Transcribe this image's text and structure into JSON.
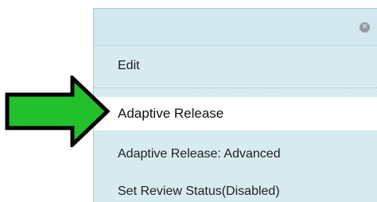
{
  "menu": {
    "close_icon": "close-icon",
    "close_glyph": "✕",
    "items": [
      {
        "label": "Edit"
      },
      {
        "label": "Adaptive Release",
        "highlighted": true
      },
      {
        "label": "Adaptive Release: Advanced"
      },
      {
        "label": "Set Review Status(Disabled)"
      }
    ]
  },
  "annotation": {
    "arrow_icon": "green-right-arrow-icon",
    "arrow_color": "#22c02a",
    "arrow_outline": "#000000"
  },
  "colors": {
    "menu_background": "#d8ebf1",
    "highlight_background": "#ffffff",
    "text": "#1f1f1f"
  }
}
